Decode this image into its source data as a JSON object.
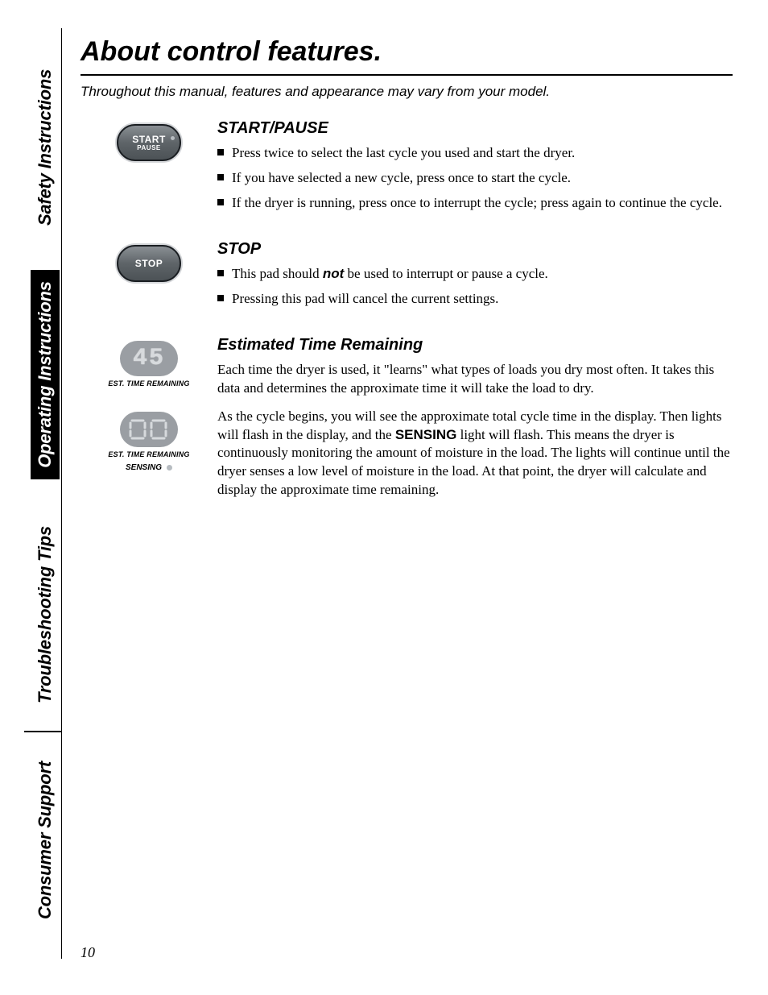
{
  "page_number": "10",
  "tabs": {
    "safety": {
      "label": "Safety Instructions"
    },
    "operate": {
      "label": "Operating Instructions"
    },
    "trouble": {
      "label": "Troubleshooting Tips"
    },
    "support": {
      "label": "Consumer Support"
    }
  },
  "title": "About control features.",
  "disclaimer": "Throughout this manual, features and appearance may vary from your model.",
  "start_pause": {
    "heading": "START/PAUSE",
    "btn_line1": "START",
    "btn_line2": "PAUSE",
    "bullets": [
      "Press twice to select the last cycle you used and start the dryer.",
      "If you have selected a new cycle, press once to start the cycle.",
      "If the dryer is running, press once to interrupt the cycle; press again to continue the cycle."
    ]
  },
  "stop": {
    "heading": "STOP",
    "btn_line1": "STOP",
    "bullet1_pre": "This pad should ",
    "bullet1_bold": "not",
    "bullet1_post": " be used to interrupt or pause a cycle.",
    "bullet2": "Pressing this pad will cancel the current settings."
  },
  "etr": {
    "heading": "Estimated Time Remaining",
    "icon1_digits": "45",
    "icon2_digits": "⎕⎕",
    "icon_label": "EST. TIME REMAINING",
    "sensing_label": "SENSING",
    "para1": "Each time the dryer is used, it \"learns\" what types of loads you dry most often. It takes this data and determines the approximate time it will take the load to dry.",
    "para2_pre": "As the cycle begins, you will see the approximate total cycle time in the display. Then lights will flash in the display, and the ",
    "para2_bold": "SENSING",
    "para2_post": " light will flash. This means the dryer is continuously monitoring the amount of moisture in the load. The lights will continue until the dryer senses a low level of moisture in the load. At that point, the dryer will calculate and display the approximate time remaining."
  }
}
